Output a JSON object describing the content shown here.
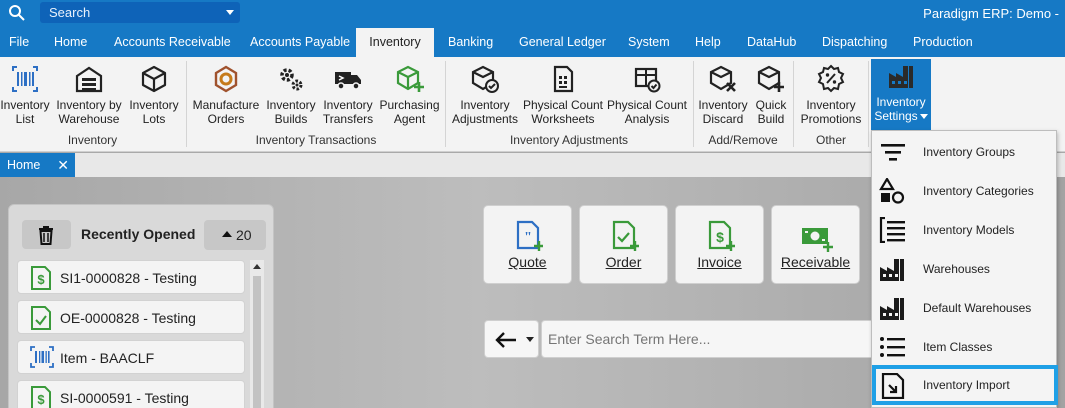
{
  "titlebar": {
    "search_placeholder": "Search",
    "app_title": "Paradigm ERP: Demo -"
  },
  "menu": {
    "tabs": [
      "File",
      "Home",
      "Accounts Receivable",
      "Accounts Payable",
      "Inventory",
      "Banking",
      "General Ledger",
      "System",
      "Help",
      "DataHub",
      "Dispatching",
      "Production"
    ],
    "active": "Inventory"
  },
  "ribbon": {
    "buttons": [
      {
        "label": "Inventory\nList",
        "icon": "barcode-icon"
      },
      {
        "label": "Inventory by\nWarehouse",
        "icon": "warehouse-icon"
      },
      {
        "label": "Inventory\nLots",
        "icon": "box-icon"
      },
      {
        "label": "Manufacture\nOrders",
        "icon": "manufacture-icon"
      },
      {
        "label": "Inventory\nBuilds",
        "icon": "gears-icon"
      },
      {
        "label": "Inventory\nTransfers",
        "icon": "truck-icon"
      },
      {
        "label": "Purchasing\nAgent",
        "icon": "cube-plus-icon"
      },
      {
        "label": "Inventory\nAdjustments",
        "icon": "box-check-icon"
      },
      {
        "label": "Physical Count\nWorksheets",
        "icon": "calculator-icon"
      },
      {
        "label": "Physical Count\nAnalysis",
        "icon": "table-check-icon"
      },
      {
        "label": "Inventory\nDiscard",
        "icon": "box-x-icon"
      },
      {
        "label": "Quick\nBuild",
        "icon": "box-plus-icon"
      },
      {
        "label": "Inventory\nPromotions",
        "icon": "badge-percent-icon"
      },
      {
        "label": "Inventory\nSettings",
        "icon": "factory-icon"
      }
    ],
    "groups": [
      "Inventory",
      "Inventory Transactions",
      "Inventory Adjustments",
      "Add/Remove",
      "Other"
    ]
  },
  "doc_tab": {
    "label": "Home",
    "close": "✕"
  },
  "recent": {
    "title": "Recently Opened",
    "count": "20",
    "items": [
      {
        "label": "SI1-0000828 - Testing",
        "icon": "invoice-icon"
      },
      {
        "label": "OE-0000828 - Testing",
        "icon": "order-icon"
      },
      {
        "label": "Item - BAACLF",
        "icon": "barcode-icon"
      },
      {
        "label": "SI-0000591 - Testing",
        "icon": "invoice-icon"
      }
    ]
  },
  "quick_actions": [
    {
      "label": "Quote",
      "icon": "quote-doc-icon"
    },
    {
      "label": "Order",
      "icon": "order-doc-icon"
    },
    {
      "label": "Invoice",
      "icon": "invoice-doc-icon"
    },
    {
      "label": "Receivable",
      "icon": "cash-plus-icon"
    }
  ],
  "search": {
    "placeholder": "Enter Search Term Here..."
  },
  "dropdown": {
    "items": [
      {
        "label": "Inventory Groups",
        "icon": "filter-icon"
      },
      {
        "label": "Inventory Categories",
        "icon": "shapes-icon"
      },
      {
        "label": "Inventory Models",
        "icon": "list-bracket-icon"
      },
      {
        "label": "Warehouses",
        "icon": "factory-icon"
      },
      {
        "label": "Default Warehouses",
        "icon": "factory-icon"
      },
      {
        "label": "Item Classes",
        "icon": "list-icon"
      },
      {
        "label": "Inventory Import",
        "icon": "import-icon"
      }
    ],
    "highlighted": "Inventory Import"
  },
  "colors": {
    "accent": "#1679c5",
    "highlight": "#1fa0e6",
    "green": "#3a9a3a",
    "blue_icon": "#2d6fc4"
  }
}
